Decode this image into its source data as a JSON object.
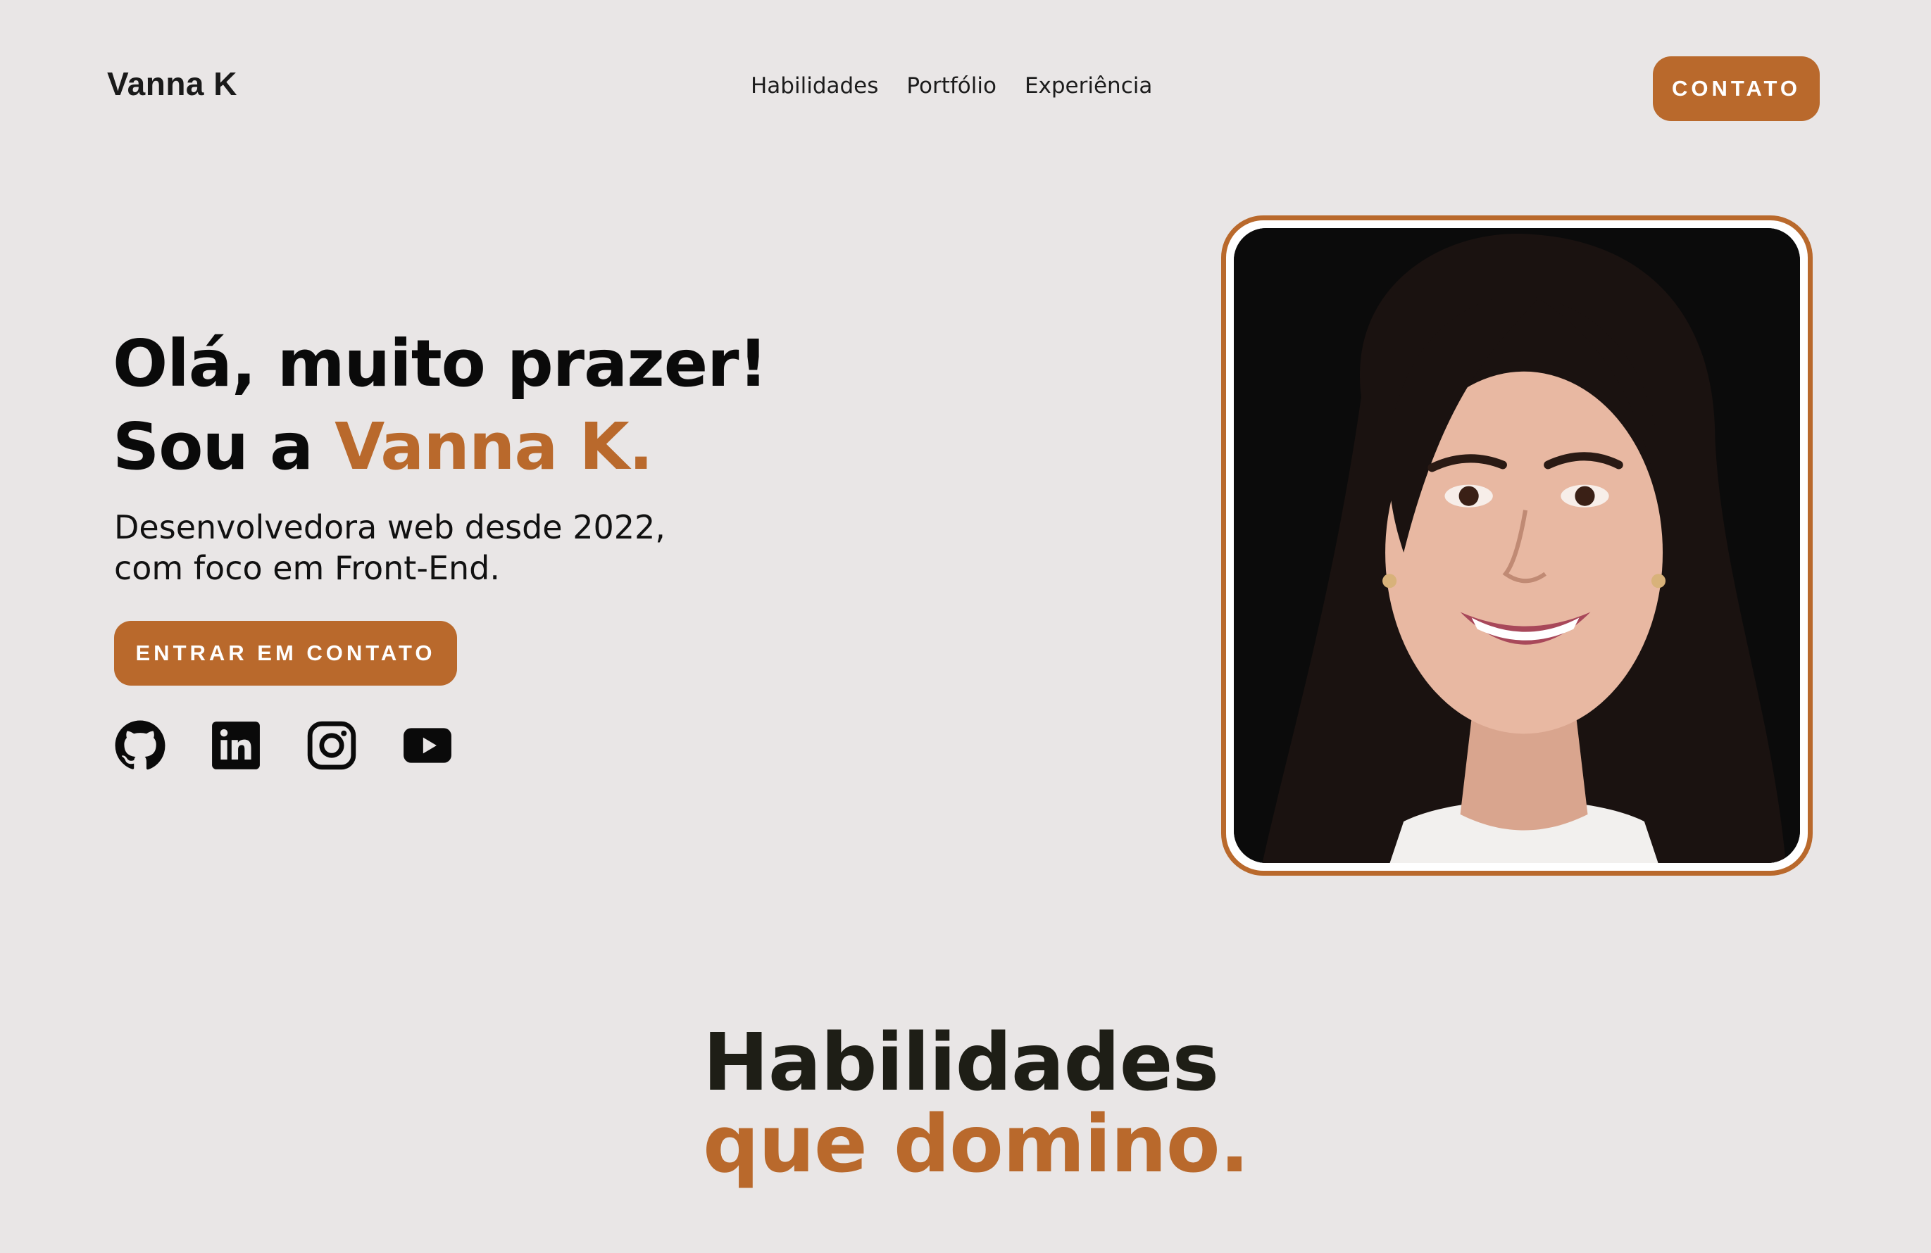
{
  "header": {
    "brand": "Vanna K",
    "nav": [
      {
        "label": "Habilidades"
      },
      {
        "label": "Portfólio"
      },
      {
        "label": "Experiência"
      }
    ],
    "contact_button": "CONTATO"
  },
  "hero": {
    "title_line1": "Olá, muito prazer!",
    "title_line2_prefix": "Sou a ",
    "title_line2_name": "Vanna K.",
    "subtitle_line1": "Desenvolvedora web desde 2022,",
    "subtitle_line2": "com foco em Front-End.",
    "cta_button": "ENTRAR EM CONTATO",
    "socials": [
      {
        "icon": "github-icon"
      },
      {
        "icon": "linkedin-icon"
      },
      {
        "icon": "instagram-icon"
      },
      {
        "icon": "youtube-icon"
      }
    ]
  },
  "skills": {
    "title_line1": "Habilidades",
    "title_line2": "que domino."
  },
  "colors": {
    "accent": "#b9692c",
    "background": "#e9e6e6",
    "text": "#0a0a0a"
  }
}
